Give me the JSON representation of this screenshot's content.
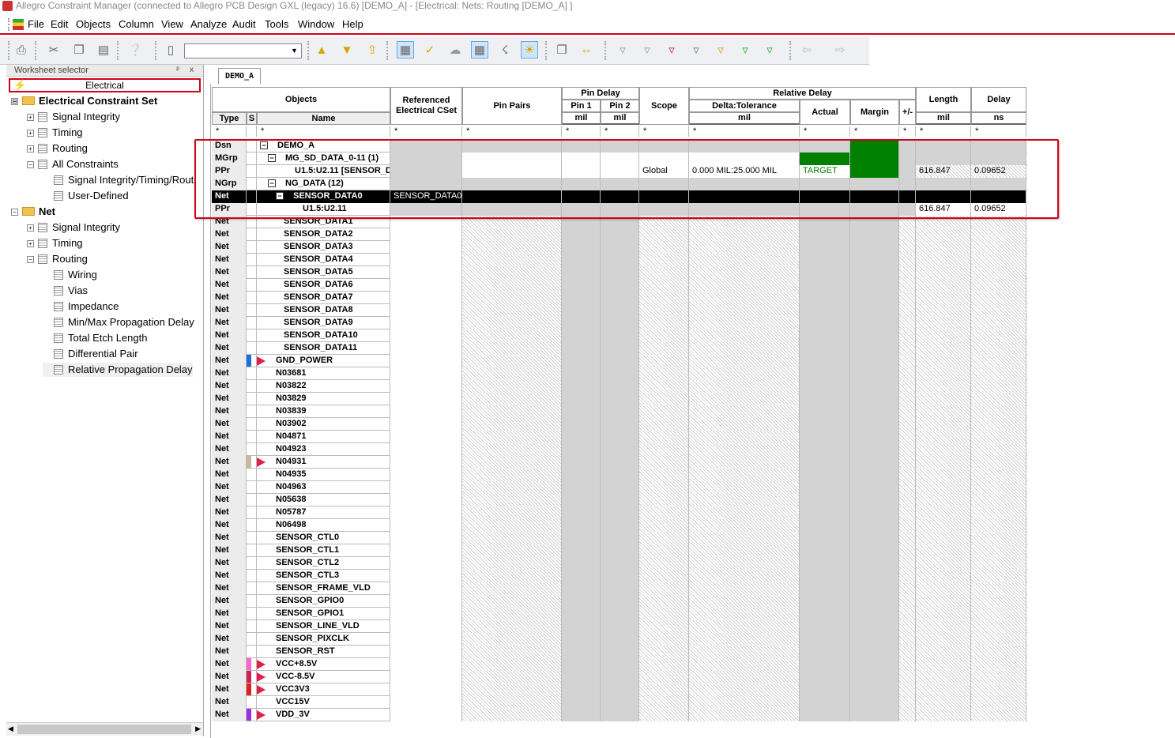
{
  "window": {
    "title": "Allegro Constraint Manager (connected to Allegro PCB Design GXL (legacy) 16.6) [DEMO_A] - [Electrical:  Nets:  Routing [DEMO_A] ]"
  },
  "menu": [
    "File",
    "Edit",
    "Objects",
    "Column",
    "View",
    "Analyze",
    "Audit",
    "Tools",
    "Window",
    "Help"
  ],
  "toolbar": {
    "combo_value": ""
  },
  "worksheet_selector": {
    "title": "Worksheet selector",
    "pin": "ᵖ",
    "close": "x",
    "domain": "Electrical",
    "tree": [
      {
        "label": "Electrical Constraint Set",
        "level": 0,
        "bold": true,
        "exp": "⊟",
        "kind": "folder"
      },
      {
        "label": "Signal Integrity",
        "level": 1,
        "exp": "+",
        "kind": "grid"
      },
      {
        "label": "Timing",
        "level": 1,
        "exp": "+",
        "kind": "grid"
      },
      {
        "label": "Routing",
        "level": 1,
        "exp": "+",
        "kind": "grid"
      },
      {
        "label": "All Constraints",
        "level": 1,
        "exp": "−",
        "kind": "grid"
      },
      {
        "label": "Signal Integrity/Timing/Rout",
        "level": 2,
        "exp": "",
        "kind": "grid"
      },
      {
        "label": "User-Defined",
        "level": 2,
        "exp": "",
        "kind": "grid"
      },
      {
        "label": "Net",
        "level": 0,
        "bold": true,
        "exp": "−",
        "kind": "folder"
      },
      {
        "label": "Signal Integrity",
        "level": 1,
        "exp": "+",
        "kind": "grid"
      },
      {
        "label": "Timing",
        "level": 1,
        "exp": "+",
        "kind": "grid"
      },
      {
        "label": "Routing",
        "level": 1,
        "exp": "−",
        "kind": "grid"
      },
      {
        "label": "Wiring",
        "level": 2,
        "exp": "",
        "kind": "grid"
      },
      {
        "label": "Vias",
        "level": 2,
        "exp": "",
        "kind": "grid"
      },
      {
        "label": "Impedance",
        "level": 2,
        "exp": "",
        "kind": "grid"
      },
      {
        "label": "Min/Max Propagation Delay",
        "level": 2,
        "exp": "",
        "kind": "grid"
      },
      {
        "label": "Total Etch Length",
        "level": 2,
        "exp": "",
        "kind": "grid"
      },
      {
        "label": "Differential Pair",
        "level": 2,
        "exp": "",
        "kind": "grid"
      },
      {
        "label": "Relative Propagation Delay",
        "level": 2,
        "exp": "",
        "kind": "grid",
        "selected": true
      }
    ]
  },
  "document_tab": "DEMO_A",
  "columns": {
    "objects": "Objects",
    "type": "Type",
    "s": "S",
    "name": "Name",
    "ref_cset": "Referenced Electrical CSet",
    "pin_pairs": "Pin Pairs",
    "pin_delay": "Pin Delay",
    "pin1": "Pin 1",
    "pin2": "Pin 2",
    "pin_unit": "mil",
    "scope": "Scope",
    "rel_delay": "Relative Delay",
    "delta_tol": "Delta:Tolerance",
    "delta_unit": "mil",
    "actual": "Actual",
    "margin": "Margin",
    "plusminus": "+/-",
    "length": "Length",
    "length_unit": "mil",
    "delay": "Delay",
    "delay_unit": "ns",
    "filter": "*"
  },
  "rows": [
    {
      "type": "Dsn",
      "name": "DEMO_A",
      "indent": 0,
      "exp": "−",
      "ref": "",
      "scope": "",
      "delta": "",
      "actual": "",
      "length": "",
      "delay": "",
      "kind": "dsn"
    },
    {
      "type": "MGrp",
      "name": "MG_SD_DATA_0-11 (1)",
      "indent": 1,
      "exp": "−",
      "ref": "",
      "scope": "",
      "delta": "",
      "actual": "",
      "length": "",
      "delay": "",
      "kind": "mgrp"
    },
    {
      "type": "PPr",
      "name": "U1.5:U2.11 [SENSOR_D",
      "indent": 2,
      "exp": "",
      "ref": "",
      "scope": "Global",
      "delta": "0.000 MIL:25.000 MIL",
      "actual": "TARGET",
      "length": "616.847",
      "delay": "0.09652",
      "kind": "ppr1"
    },
    {
      "type": "NGrp",
      "name": "NG_DATA (12)",
      "indent": 1,
      "exp": "−",
      "ref": "",
      "scope": "",
      "delta": "",
      "actual": "",
      "length": "",
      "delay": "",
      "kind": "ngrp"
    },
    {
      "type": "Net",
      "name": "SENSOR_DATA0",
      "indent": 2,
      "exp": "−",
      "ref": "SENSOR_DATA0",
      "scope": "",
      "delta": "",
      "actual": "",
      "length": "",
      "delay": "",
      "kind": "sel"
    },
    {
      "type": "PPr",
      "name": "U1.5:U2.11",
      "indent": 3,
      "exp": "",
      "ref": "",
      "scope": "",
      "delta": "",
      "actual": "",
      "length": "616.847",
      "delay": "0.09652",
      "kind": "ppr2"
    },
    {
      "type": "Net",
      "name": "SENSOR_DATA1",
      "indent": 2,
      "kind": "net"
    },
    {
      "type": "Net",
      "name": "SENSOR_DATA2",
      "indent": 2,
      "kind": "net"
    },
    {
      "type": "Net",
      "name": "SENSOR_DATA3",
      "indent": 2,
      "kind": "net"
    },
    {
      "type": "Net",
      "name": "SENSOR_DATA4",
      "indent": 2,
      "kind": "net"
    },
    {
      "type": "Net",
      "name": "SENSOR_DATA5",
      "indent": 2,
      "kind": "net"
    },
    {
      "type": "Net",
      "name": "SENSOR_DATA6",
      "indent": 2,
      "kind": "net"
    },
    {
      "type": "Net",
      "name": "SENSOR_DATA7",
      "indent": 2,
      "kind": "net"
    },
    {
      "type": "Net",
      "name": "SENSOR_DATA8",
      "indent": 2,
      "kind": "net"
    },
    {
      "type": "Net",
      "name": "SENSOR_DATA9",
      "indent": 2,
      "kind": "net"
    },
    {
      "type": "Net",
      "name": "SENSOR_DATA10",
      "indent": 2,
      "kind": "net"
    },
    {
      "type": "Net",
      "name": "SENSOR_DATA11",
      "indent": 2,
      "kind": "net"
    },
    {
      "type": "Net",
      "name": "GND_POWER",
      "indent": 1,
      "kind": "net",
      "swatch": "#1e6fd9",
      "flag": true
    },
    {
      "type": "Net",
      "name": "N03681",
      "indent": 1,
      "kind": "net"
    },
    {
      "type": "Net",
      "name": "N03822",
      "indent": 1,
      "kind": "net"
    },
    {
      "type": "Net",
      "name": "N03829",
      "indent": 1,
      "kind": "net"
    },
    {
      "type": "Net",
      "name": "N03839",
      "indent": 1,
      "kind": "net"
    },
    {
      "type": "Net",
      "name": "N03902",
      "indent": 1,
      "kind": "net"
    },
    {
      "type": "Net",
      "name": "N04871",
      "indent": 1,
      "kind": "net"
    },
    {
      "type": "Net",
      "name": "N04923",
      "indent": 1,
      "kind": "net"
    },
    {
      "type": "Net",
      "name": "N04931",
      "indent": 1,
      "kind": "net",
      "swatch": "#c9b89a",
      "flag": true
    },
    {
      "type": "Net",
      "name": "N04935",
      "indent": 1,
      "kind": "net"
    },
    {
      "type": "Net",
      "name": "N04963",
      "indent": 1,
      "kind": "net"
    },
    {
      "type": "Net",
      "name": "N05638",
      "indent": 1,
      "kind": "net"
    },
    {
      "type": "Net",
      "name": "N05787",
      "indent": 1,
      "kind": "net"
    },
    {
      "type": "Net",
      "name": "N06498",
      "indent": 1,
      "kind": "net"
    },
    {
      "type": "Net",
      "name": "SENSOR_CTL0",
      "indent": 1,
      "kind": "net"
    },
    {
      "type": "Net",
      "name": "SENSOR_CTL1",
      "indent": 1,
      "kind": "net"
    },
    {
      "type": "Net",
      "name": "SENSOR_CTL2",
      "indent": 1,
      "kind": "net"
    },
    {
      "type": "Net",
      "name": "SENSOR_CTL3",
      "indent": 1,
      "kind": "net"
    },
    {
      "type": "Net",
      "name": "SENSOR_FRAME_VLD",
      "indent": 1,
      "kind": "net"
    },
    {
      "type": "Net",
      "name": "SENSOR_GPIO0",
      "indent": 1,
      "kind": "net"
    },
    {
      "type": "Net",
      "name": "SENSOR_GPIO1",
      "indent": 1,
      "kind": "net"
    },
    {
      "type": "Net",
      "name": "SENSOR_LINE_VLD",
      "indent": 1,
      "kind": "net"
    },
    {
      "type": "Net",
      "name": "SENSOR_PIXCLK",
      "indent": 1,
      "kind": "net"
    },
    {
      "type": "Net",
      "name": "SENSOR_RST",
      "indent": 1,
      "kind": "net"
    },
    {
      "type": "Net",
      "name": "VCC+8.5V",
      "indent": 1,
      "kind": "net",
      "swatch": "#ff66cc",
      "flag": true
    },
    {
      "type": "Net",
      "name": "VCC-8.5V",
      "indent": 1,
      "kind": "net",
      "swatch": "#cc2255",
      "flag": true
    },
    {
      "type": "Net",
      "name": "VCC3V3",
      "indent": 1,
      "kind": "net",
      "swatch": "#e02020",
      "flag": true
    },
    {
      "type": "Net",
      "name": "VCC15V",
      "indent": 1,
      "kind": "net"
    },
    {
      "type": "Net",
      "name": "VDD_3V",
      "indent": 1,
      "kind": "net",
      "swatch": "#9b30e0",
      "flag": true
    }
  ],
  "colors": {
    "highlight_box": "#d0021b",
    "margin_green": "#008000",
    "selected_ref": "#ffd21f"
  }
}
